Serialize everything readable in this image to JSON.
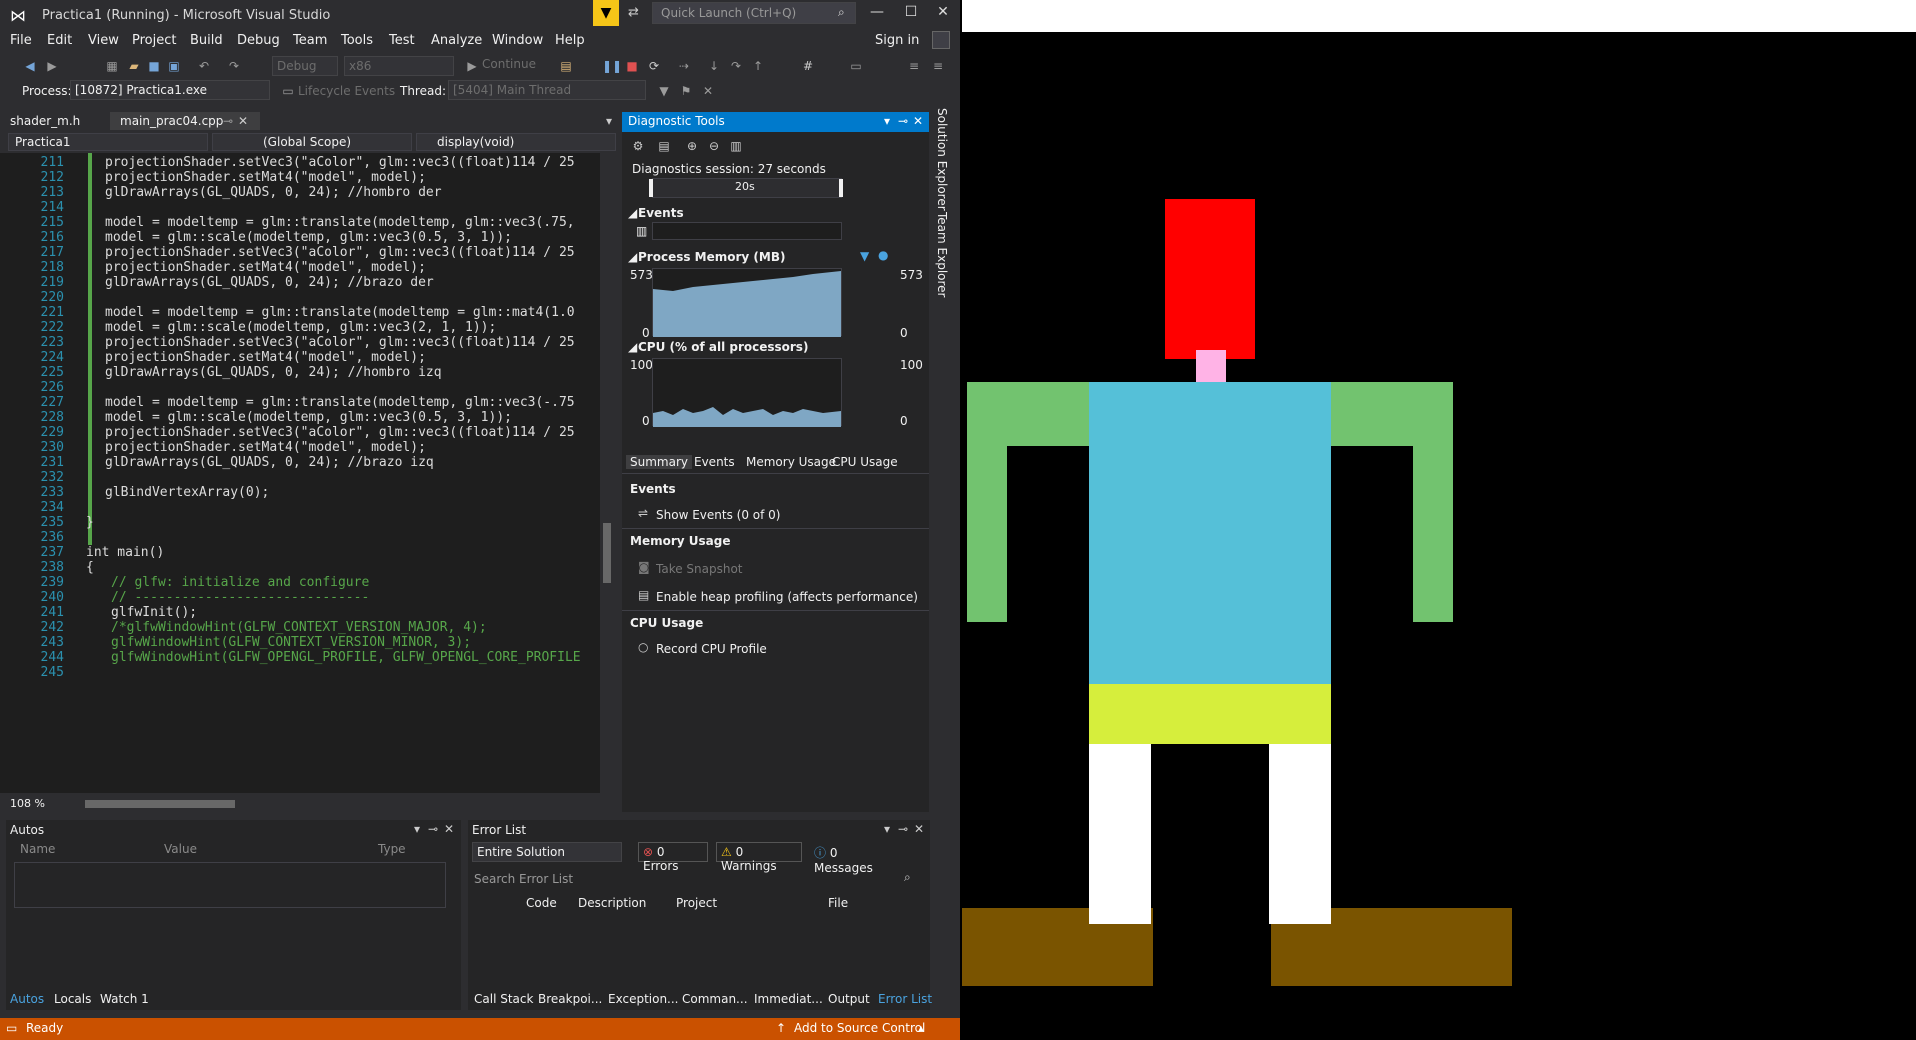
{
  "titlebar": {
    "title": "Practica1 (Running) - Microsoft Visual Studio",
    "quick_launch_placeholder": "Quick Launch (Ctrl+Q)"
  },
  "menu": {
    "file": "File",
    "edit": "Edit",
    "view": "View",
    "project": "Project",
    "build": "Build",
    "debug": "Debug",
    "team": "Team",
    "tools": "Tools",
    "test": "Test",
    "analyze": "Analyze",
    "window": "Window",
    "help": "Help",
    "signin": "Sign in"
  },
  "toolbar": {
    "config": "Debug",
    "platform": "x86",
    "continue": "Continue",
    "process_label": "Process:",
    "process_value": "[10872] Practica1.exe",
    "lifecycle": "Lifecycle Events",
    "thread_label": "Thread:",
    "thread_value": "[5404] Main Thread"
  },
  "tabs": {
    "tab1": "shader_m.h",
    "tab2": "main_prac04.cpp"
  },
  "nav": {
    "project": "Practica1",
    "scope": "(Global Scope)",
    "member": "display(void)"
  },
  "code": [
    {
      "n": "211",
      "t": "projectionShader.setVec3(\"aColor\", glm::vec3((float)114 / 25"
    },
    {
      "n": "212",
      "t": "projectionShader.setMat4(\"model\", model);"
    },
    {
      "n": "213",
      "t": "glDrawArrays(GL_QUADS, 0, 24); //hombro der"
    },
    {
      "n": "214",
      "t": ""
    },
    {
      "n": "215",
      "t": "model = modeltemp = glm::translate(modeltemp, glm::vec3(.75,"
    },
    {
      "n": "216",
      "t": "model = glm::scale(modeltemp, glm::vec3(0.5, 3, 1));"
    },
    {
      "n": "217",
      "t": "projectionShader.setVec3(\"aColor\", glm::vec3((float)114 / 25"
    },
    {
      "n": "218",
      "t": "projectionShader.setMat4(\"model\", model);"
    },
    {
      "n": "219",
      "t": "glDrawArrays(GL_QUADS, 0, 24); //brazo der"
    },
    {
      "n": "220",
      "t": ""
    },
    {
      "n": "221",
      "t": "model = modeltemp = glm::translate(modeltemp = glm::mat4(1.0"
    },
    {
      "n": "222",
      "t": "model = glm::scale(modeltemp, glm::vec3(2, 1, 1));"
    },
    {
      "n": "223",
      "t": "projectionShader.setVec3(\"aColor\", glm::vec3((float)114 / 25"
    },
    {
      "n": "224",
      "t": "projectionShader.setMat4(\"model\", model);"
    },
    {
      "n": "225",
      "t": "glDrawArrays(GL_QUADS, 0, 24); //hombro izq"
    },
    {
      "n": "226",
      "t": ""
    },
    {
      "n": "227",
      "t": "model = modeltemp = glm::translate(modeltemp, glm::vec3(-.75"
    },
    {
      "n": "228",
      "t": "model = glm::scale(modeltemp, glm::vec3(0.5, 3, 1));"
    },
    {
      "n": "229",
      "t": "projectionShader.setVec3(\"aColor\", glm::vec3((float)114 / 25"
    },
    {
      "n": "230",
      "t": "projectionShader.setMat4(\"model\", model);"
    },
    {
      "n": "231",
      "t": "glDrawArrays(GL_QUADS, 0, 24); //brazo izq"
    },
    {
      "n": "232",
      "t": ""
    },
    {
      "n": "233",
      "t": "glBindVertexArray(0);"
    },
    {
      "n": "234",
      "t": ""
    },
    {
      "n": "235",
      "t": "}"
    },
    {
      "n": "236",
      "t": ""
    },
    {
      "n": "237",
      "t": "int main()"
    },
    {
      "n": "238",
      "t": "{"
    },
    {
      "n": "239",
      "t": "// glfw: initialize and configure"
    },
    {
      "n": "240",
      "t": "// ------------------------------"
    },
    {
      "n": "241",
      "t": "glfwInit();"
    },
    {
      "n": "242",
      "t": "/*glfwWindowHint(GLFW_CONTEXT_VERSION_MAJOR, 4);"
    },
    {
      "n": "243",
      "t": "glfwWindowHint(GLFW_CONTEXT_VERSION_MINOR, 3);"
    },
    {
      "n": "244",
      "t": "glfwWindowHint(GLFW_OPENGL_PROFILE, GLFW_OPENGL_CORE_PROFILE"
    },
    {
      "n": "245",
      "t": ""
    }
  ],
  "editor": {
    "zoom": "108 %"
  },
  "diag": {
    "title": "Diagnostic Tools",
    "session": "Diagnostics session: 27 seconds",
    "timeline_label": "20s",
    "events": "Events",
    "process_memory": "Process Memory (MB)",
    "mem_top_left": "573",
    "mem_top_right": "573",
    "mem_bottom_left": "0",
    "mem_bottom_right": "0",
    "cpu": "CPU (% of all processors)",
    "cpu_top_left": "100",
    "cpu_top_right": "100",
    "cpu_bottom_left": "0",
    "cpu_bottom_right": "0",
    "tab_summary": "Summary",
    "tab_events": "Events",
    "tab_memory": "Memory Usage",
    "tab_cpu": "CPU Usage",
    "sec_events": "Events",
    "show_events": "Show Events (0 of 0)",
    "sec_memory": "Memory Usage",
    "take_snapshot": "Take Snapshot",
    "heap_profiling": "Enable heap profiling (affects performance)",
    "sec_cpu": "CPU Usage",
    "record_cpu": "Record CPU Profile"
  },
  "side": {
    "solution_explorer": "Solution Explorer",
    "team_explorer": "Team Explorer"
  },
  "autos": {
    "title": "Autos",
    "col_name": "Name",
    "col_value": "Value",
    "col_type": "Type",
    "tab_autos": "Autos",
    "tab_locals": "Locals",
    "tab_watch": "Watch 1"
  },
  "errors": {
    "title": "Error List",
    "scope": "Entire Solution",
    "errors": "0 Errors",
    "warnings": "0 Warnings",
    "messages": "0 Messages",
    "search_placeholder": "Search Error List",
    "col_code": "Code",
    "col_desc": "Description",
    "col_project": "Project",
    "col_file": "File"
  },
  "bottom_tabs": {
    "callstack": "Call Stack",
    "breakpoints": "Breakpoi...",
    "exceptions": "Exception...",
    "command": "Comman...",
    "immediate": "Immediat...",
    "output": "Output",
    "errorlist": "Error List"
  },
  "status": {
    "ready": "Ready",
    "source_control": "Add to Source Control"
  },
  "colors": {
    "head": "#ff0000",
    "neck": "#ffb3e6",
    "shirt": "#55c0d8",
    "arms": "#72c36f",
    "belt": "#d6ee3c",
    "legs": "#ffffff",
    "floor": "#7a5400",
    "status": "#ca5100",
    "accent": "#007acc"
  }
}
